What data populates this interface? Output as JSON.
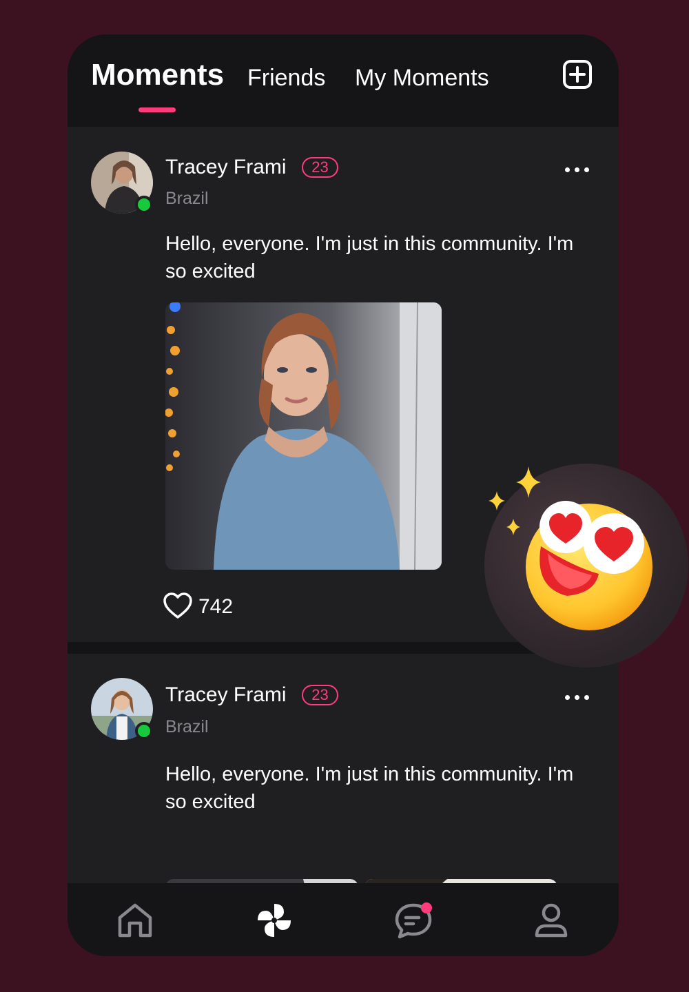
{
  "tabs": [
    {
      "label": "Moments"
    },
    {
      "label": "Friends"
    },
    {
      "label": "My Moments"
    }
  ],
  "posts": [
    {
      "name": "Tracey Frami",
      "age": "23",
      "country": "Brazil",
      "text": "Hello, everyone. I'm just in this community. I'm so excited",
      "likes": "742",
      "online": true
    },
    {
      "name": "Tracey Frami",
      "age": "23",
      "country": "Brazil",
      "text": "Hello, everyone. I'm just in this community. I'm so excited",
      "online": true
    }
  ],
  "nav": [
    {
      "icon": "home-icon"
    },
    {
      "icon": "moments-pinwheel-icon",
      "active": true
    },
    {
      "icon": "chat-icon",
      "has_notification": true
    },
    {
      "icon": "profile-icon"
    }
  ],
  "colors": {
    "background": "#3d1220",
    "phone": "#141416",
    "card": "#1f1f21",
    "accent": "#ff3d7c",
    "online": "#19c93d",
    "muted": "#8a8a8e"
  }
}
